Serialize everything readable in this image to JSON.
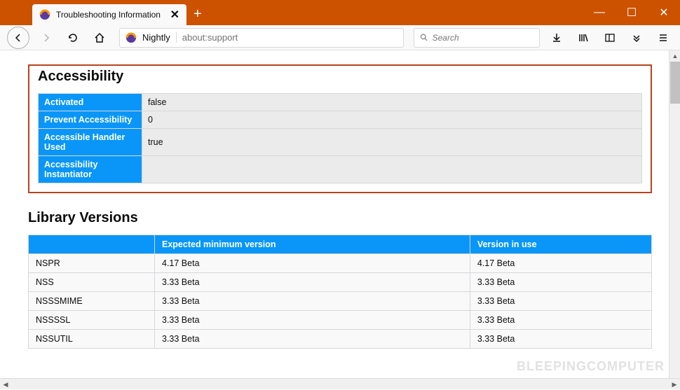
{
  "titlebar": {
    "tab_title": "Troubleshooting Information",
    "window": {
      "minimize": "—",
      "maximize": "☐",
      "close": "✕"
    }
  },
  "navbar": {
    "identity": "Nightly",
    "url": "about:support",
    "search_placeholder": "Search"
  },
  "accessibility": {
    "heading": "Accessibility",
    "rows": [
      {
        "label": "Activated",
        "value": "false"
      },
      {
        "label": "Prevent Accessibility",
        "value": "0"
      },
      {
        "label": "Accessible Handler Used",
        "value": "true"
      },
      {
        "label": "Accessibility Instantiator",
        "value": ""
      }
    ]
  },
  "library": {
    "heading": "Library Versions",
    "headers": {
      "blank": "",
      "expected": "Expected minimum version",
      "inuse": "Version in use"
    },
    "rows": [
      {
        "name": "NSPR",
        "expected": "4.17 Beta",
        "inuse": "4.17 Beta"
      },
      {
        "name": "NSS",
        "expected": "3.33 Beta",
        "inuse": "3.33 Beta"
      },
      {
        "name": "NSSSMIME",
        "expected": "3.33 Beta",
        "inuse": "3.33 Beta"
      },
      {
        "name": "NSSSSL",
        "expected": "3.33 Beta",
        "inuse": "3.33 Beta"
      },
      {
        "name": "NSSUTIL",
        "expected": "3.33 Beta",
        "inuse": "3.33 Beta"
      }
    ]
  },
  "watermark": "BLEEPINGCOMPUTER"
}
